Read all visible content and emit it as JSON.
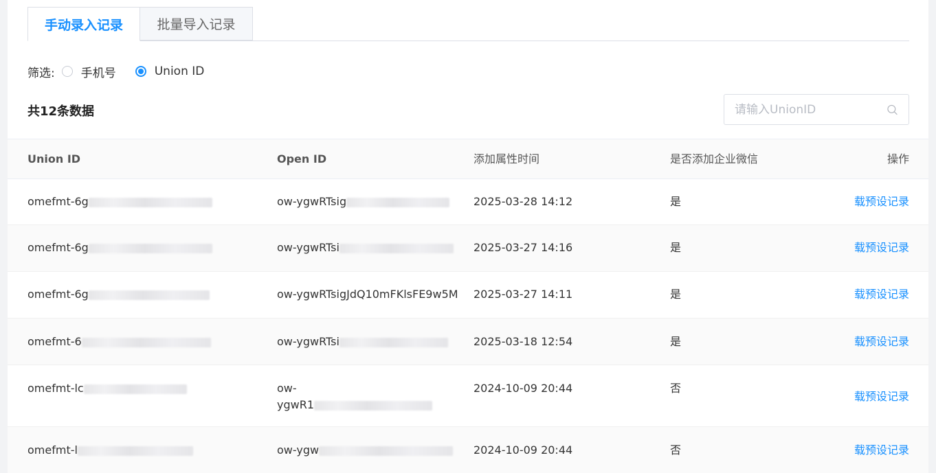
{
  "tabs": [
    {
      "label": "手动录入记录",
      "active": true
    },
    {
      "label": "批量导入记录",
      "active": false
    }
  ],
  "filter": {
    "label": "筛选:",
    "options": [
      {
        "label": "手机号",
        "checked": false
      },
      {
        "label": "Union ID",
        "checked": true
      }
    ]
  },
  "summary": {
    "count_text": "共12条数据"
  },
  "search": {
    "placeholder": "请输入UnionID",
    "icon": "search-icon"
  },
  "table": {
    "headers": {
      "union_id": "Union ID",
      "open_id": "Open ID",
      "time": "添加属性时间",
      "wecom": "是否添加企业微信",
      "action": "操作"
    },
    "rows": [
      {
        "union_id": "omefmt-6g",
        "open_id": "ow-ygwRTsig",
        "time": "2025-03-28 14:12",
        "wecom": "是",
        "action": "载预设记录"
      },
      {
        "union_id": "omefmt-6g",
        "open_id": "ow-ygwRTsi",
        "time": "2025-03-27 14:16",
        "wecom": "是",
        "action": "载预设记录"
      },
      {
        "union_id": "omefmt-6g",
        "open_id": "ow-ygwRTsigJdQ10mFKlsFE9w5M",
        "time": "2025-03-27 14:11",
        "wecom": "是",
        "action": "载预设记录"
      },
      {
        "union_id": "omefmt-6",
        "open_id": "ow-ygwRTsi",
        "time": "2025-03-18 12:54",
        "wecom": "是",
        "action": "载预设记录"
      },
      {
        "union_id": "omefmt-lc",
        "open_id_line1": "ow-",
        "open_id_line2": "ygwR1",
        "time": "2024-10-09 20:44",
        "wecom": "否",
        "action": "载预设记录"
      },
      {
        "union_id": "omefmt-l",
        "open_id": "ow-ygw",
        "time": "2024-10-09 20:44",
        "wecom": "否",
        "action": "载预设记录"
      }
    ]
  }
}
